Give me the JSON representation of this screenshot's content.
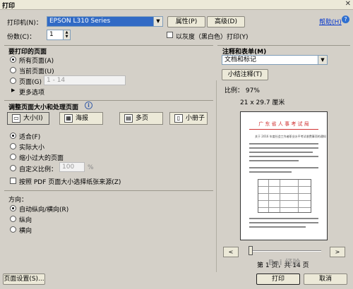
{
  "window": {
    "title": "打印",
    "close_glyph": "✕"
  },
  "printer": {
    "label": "打印机(N)：",
    "value": "EPSON L310 Series",
    "properties_button": "属性(P)",
    "advanced_button": "高级(D)",
    "help_link": "帮助(H)",
    "help_icon": "question-icon"
  },
  "copies": {
    "label": "份数(C)：",
    "value": "1",
    "grayscale_label": "以灰度（黑白色）打印(Y)"
  },
  "pages_section": {
    "heading": "要打印的页面",
    "all_pages": "所有页面(A)",
    "current_page": "当前页面(U)",
    "pages_label": "页面(G)",
    "pages_placeholder": "1 - 14",
    "more_options": "更多选项"
  },
  "sizing_section": {
    "heading": "调整页面大小和处理页面",
    "info_icon": "info-icon",
    "tabs": [
      "大小(I)",
      "海报",
      "多页",
      "小册子"
    ],
    "fit": "适合(F)",
    "actual_size": "实际大小",
    "shrink_oversized": "缩小过大的页面",
    "custom_scale_label": "自定义比例：",
    "custom_scale_value": "100",
    "custom_scale_unit": "%",
    "paper_source_by_pdf": "按照 PDF 页面大小选择纸张来源(Z)"
  },
  "orientation_section": {
    "heading": "方向：",
    "auto": "自动纵向/横向(R)",
    "portrait": "纵向",
    "landscape": "横向"
  },
  "comments_section": {
    "heading": "注释和表单(M)",
    "selected": "文档和标记",
    "summarize_button": "小结注释(T)"
  },
  "preview": {
    "scale": "比例： 97%",
    "paper_size": "21 x 29.7 厘米",
    "doc_header": "广 东 省 人 事 考 试 局",
    "doc_subtitle": "关于 2016 年度社会工作者职业水平考试收费事项的通知",
    "page_indicator": "第 1 页，共 14 页",
    "prev": "<",
    "next": ">"
  },
  "footer": {
    "page_setup_button": "页面设置(S)...",
    "print_button": "打印",
    "cancel_button": "取消"
  },
  "watermark": "Bai 经验"
}
